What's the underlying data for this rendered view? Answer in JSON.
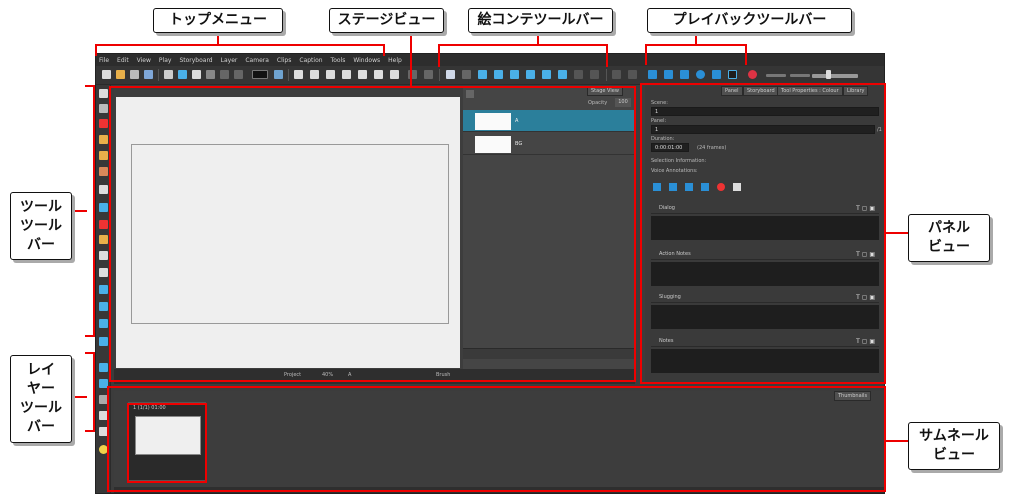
{
  "menu": {
    "items": [
      "File",
      "Edit",
      "View",
      "Play",
      "Storyboard",
      "Layer",
      "Camera",
      "Clips",
      "Caption",
      "Tools",
      "Windows",
      "Help"
    ]
  },
  "stage": {
    "tab_label": "Stage View",
    "opacity_label": "Opacity",
    "opacity_value": "100",
    "layers": [
      {
        "name": "A"
      },
      {
        "name": "BG"
      }
    ],
    "bottom": {
      "project_label": "Project",
      "zoom": "40%",
      "view_mode": "A",
      "brush_label": "Brush"
    }
  },
  "panel": {
    "tabs": [
      "Panel",
      "Storyboard",
      "Tool Properties : Colour",
      "Library"
    ],
    "scene_label": "Scene:",
    "scene_value": "1",
    "panel_label": "Panel:",
    "panel_value": "1",
    "panel_total": "/1",
    "duration_label": "Duration:",
    "duration_value": "0:00:01:00",
    "duration_frames": "(24 frames)",
    "selection_info": "Selection Information:",
    "voice_annotations": "Voice Annotations:",
    "sections": [
      "Dialog",
      "Action Notes",
      "Slugging",
      "Notes"
    ]
  },
  "thumbnails": {
    "tab_label": "Thumbnails",
    "card_label": "1 (1/1) 01:00"
  },
  "callouts": {
    "top_menu": "トップメニュー",
    "stage_view": "ステージビュー",
    "storyboard_toolbar": "絵コンテツールバー",
    "playback_toolbar": "プレイバックツールバー",
    "tools_toolbar_1": "ツール",
    "tools_toolbar_2": "ツール",
    "tools_toolbar_3": "バー",
    "layer_toolbar_1": "レイ",
    "layer_toolbar_2": "ヤー",
    "layer_toolbar_3": "ツール",
    "layer_toolbar_4": "バー",
    "panel_view_1": "パネル",
    "panel_view_2": "ビュー",
    "thumbnail_view_1": "サムネール",
    "thumbnail_view_2": "ビュー"
  },
  "colors": {
    "highlight": "#e00000",
    "accent_blue": "#2a8fd6",
    "selected_layer": "#2b7f9b"
  }
}
